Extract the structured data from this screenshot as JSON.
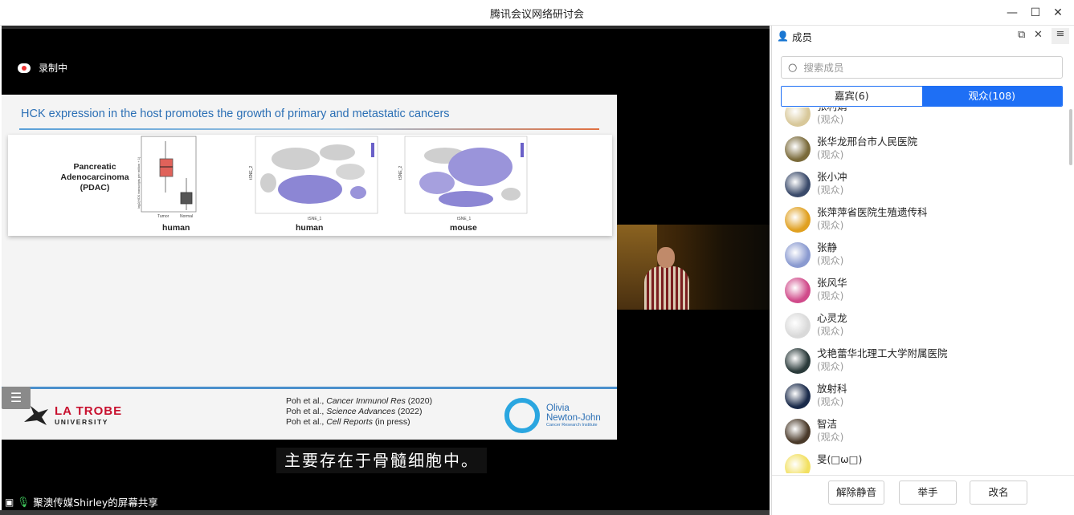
{
  "window": {
    "title": "腾讯会议网络研讨会",
    "minimize_glyph": "—",
    "maximize_glyph": "☐",
    "close_glyph": "✕"
  },
  "stage": {
    "recording_label": "录制中",
    "subtitle": "主要存在于骨髓细胞中。",
    "share_label": "聚澳传媒Shirley的屏幕共享"
  },
  "slide": {
    "title": "HCK expression in the host promotes the growth of primary and metastatic cancers",
    "row_label": "Pancreatic Adenocarcinoma (PDAC)",
    "panel_labels": [
      "human",
      "human",
      "mouse"
    ],
    "boxplot_x_labels": [
      "Tumor",
      "Normal"
    ],
    "boxplot_y_label": "log2(HCK transcripts per million + 1)",
    "tsne_x_label": "tSNE_1",
    "tsne_y_label": "tSNE_2",
    "logo_left_line1": "LA TROBE",
    "logo_left_line2": "UNIVERSITY",
    "refs": [
      {
        "authors": "Poh et al., ",
        "journal": "Cancer Immunol Res",
        "year": " (2020)"
      },
      {
        "authors": "Poh et al., ",
        "journal": "Science Advances",
        "year": " (2022)"
      },
      {
        "authors": "Poh et al., ",
        "journal": "Cell Reports",
        "year": " (in press)"
      }
    ],
    "logo_right_line1": "Olivia",
    "logo_right_line2": "Newton-John",
    "logo_right_line3": "Cancer Research Institute"
  },
  "panel": {
    "title": "成员",
    "search_placeholder": "搜索成员",
    "tabs": [
      {
        "label": "嘉宾(6)",
        "active": false
      },
      {
        "label": "观众(108)",
        "active": true
      }
    ],
    "members": [
      {
        "name": "张利娟",
        "role": "(观众)",
        "avatar_color": "#d8c89a"
      },
      {
        "name": "张华龙邢台市人民医院",
        "role": "(观众)",
        "avatar_color": "#7a6a3a"
      },
      {
        "name": "张小冲",
        "role": "(观众)",
        "avatar_color": "#3a4a6a"
      },
      {
        "name": "张萍萍省医院生殖遗传科",
        "role": "(观众)",
        "avatar_color": "#e0a020"
      },
      {
        "name": "张静",
        "role": "(观众)",
        "avatar_color": "#8a9ad0"
      },
      {
        "name": "张风华",
        "role": "(观众)",
        "avatar_color": "#d04a8a"
      },
      {
        "name": "心灵龙",
        "role": "(观众)",
        "avatar_color": "#d9d9d9"
      },
      {
        "name": "戈艳蕾华北理工大学附属医院",
        "role": "(观众)",
        "avatar_color": "#2a3a3a"
      },
      {
        "name": "放射科",
        "role": "(观众)",
        "avatar_color": "#1a2a4a"
      },
      {
        "name": "智洁",
        "role": "(观众)",
        "avatar_color": "#4a3a2a"
      },
      {
        "name": "旻(□ω□)",
        "role": "",
        "avatar_color": "#f2e060"
      }
    ],
    "buttons": {
      "unmute": "解除静音",
      "raise_hand": "举手",
      "rename": "改名"
    }
  }
}
